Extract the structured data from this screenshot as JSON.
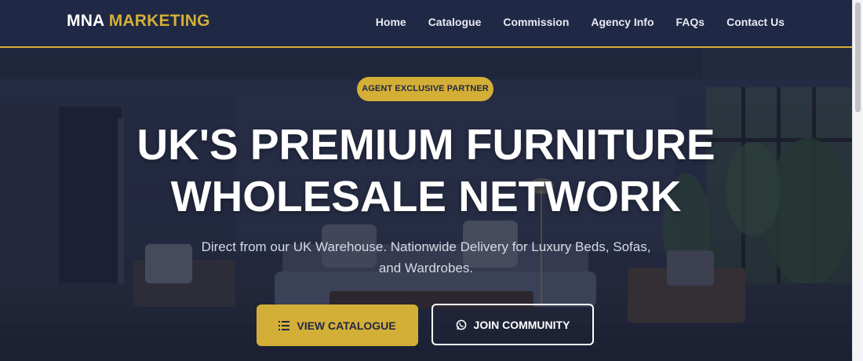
{
  "header": {
    "logo_main": "MNA",
    "logo_accent": "MARKETING",
    "nav": [
      "Home",
      "Catalogue",
      "Commission",
      "Agency Info",
      "FAQs",
      "Contact Us"
    ]
  },
  "hero": {
    "badge": "AGENT EXCLUSIVE PARTNER",
    "title_line1": "UK'S PREMIUM FURNITURE",
    "title_line2": "WHOLESALE NETWORK",
    "subtitle": "Direct from our UK Warehouse. Nationwide Delivery for Luxury Beds, Sofas, and Wardrobes.",
    "primary_button": "VIEW CATALOGUE",
    "secondary_button": "JOIN COMMUNITY"
  },
  "icons": {
    "primary_button_icon": "list-icon",
    "secondary_button_icon": "whatsapp-icon"
  },
  "colors": {
    "navy": "#1f2844",
    "gold": "#d4af37",
    "white": "#ffffff"
  }
}
